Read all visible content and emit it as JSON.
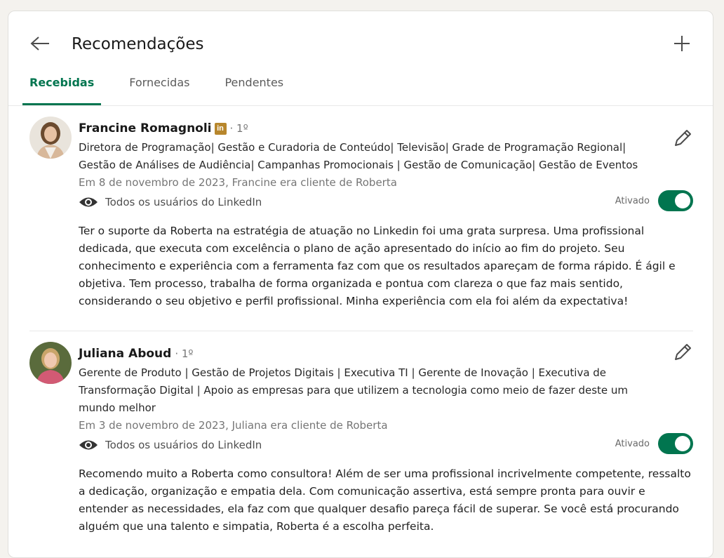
{
  "header": {
    "title": "Recomendações",
    "tabs": [
      {
        "label": "Recebidas",
        "active": true
      },
      {
        "label": "Fornecidas",
        "active": false
      },
      {
        "label": "Pendentes",
        "active": false
      }
    ]
  },
  "recommendations": [
    {
      "name": "Francine Romagnoli",
      "badge": "in",
      "degree": "· 1º",
      "headline": "Diretora de Programação| Gestão e Curadoria de Conteúdo| Televisão| Grade de Programação Regional| Gestão de Análises de Audiência| Campanhas Promocionais | Gestão de Comunicação| Gestão de Eventos",
      "date": "Em 8 de novembro de 2023, Francine era cliente de Roberta",
      "visibility": "Todos os usuários do LinkedIn",
      "toggle_label": "Ativado",
      "text": "Ter o suporte da Roberta na estratégia de atuação no Linkedin foi uma grata surpresa. Uma profissional dedicada, que executa com excelência o plano de ação apresentado do início ao fim do projeto. Seu conhecimento e experiência com a ferramenta faz com que os resultados apareçam de forma rápido. É ágil e objetiva. Tem processo, trabalha de forma organizada e pontua com clareza o que faz mais sentido, considerando o seu objetivo e perfil profissional. Minha experiência com ela foi além da expectativa!"
    },
    {
      "name": "Juliana Aboud",
      "degree": "· 1º",
      "headline": "Gerente de Produto | Gestão de Projetos Digitais | Executiva TI | Gerente de Inovação | Executiva de Transformação Digital | Apoio as empresas para que utilizem a tecnologia como meio de fazer deste um mundo melhor",
      "date": "Em 3 de novembro de 2023, Juliana era cliente de Roberta",
      "visibility": "Todos os usuários do LinkedIn",
      "toggle_label": "Ativado",
      "text": "Recomendo muito a Roberta como consultora! Além de ser uma profissional incrivelmente competente, ressalto a dedicação, organização e empatia dela. Com comunicação assertiva, está sempre pronta para ouvir e entender as necessidades, ela faz com que qualquer desafio pareça fácil de superar. Se você está procurando alguém que una talento e simpatia, Roberta é a escolha perfeita."
    }
  ],
  "colors": {
    "accent": "#01754f",
    "badge": "#b7862c"
  }
}
